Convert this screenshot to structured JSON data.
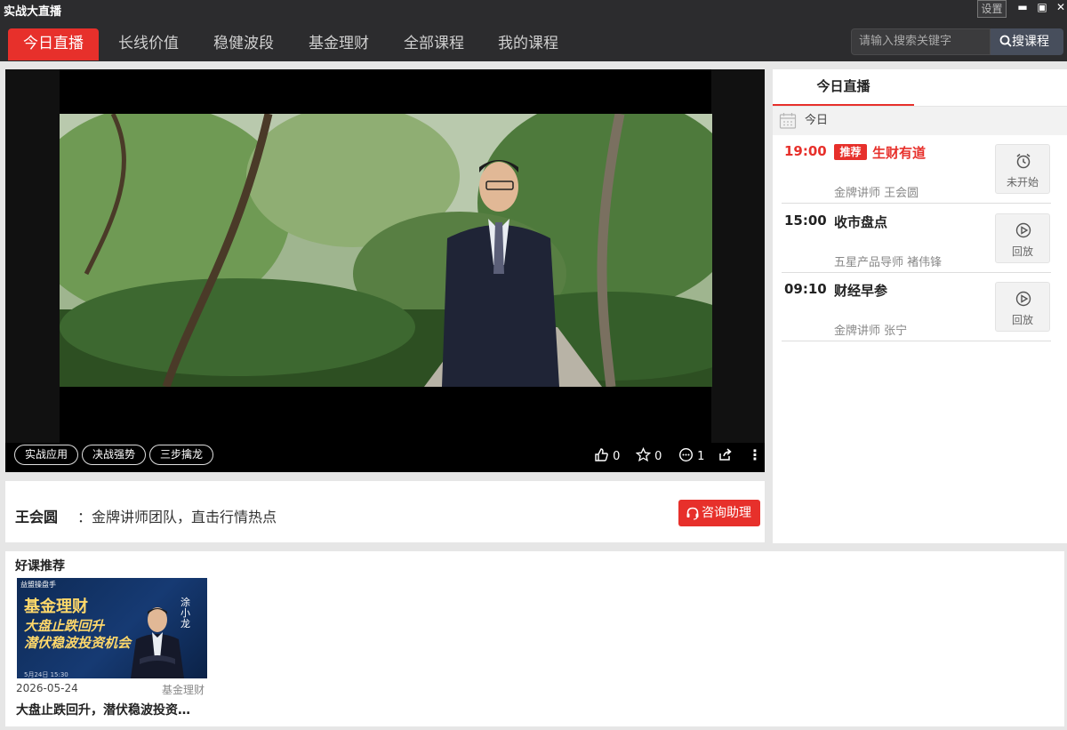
{
  "window": {
    "title": "实战大直播",
    "settings_label": "设置",
    "minimize_glyph": "▬",
    "maximize_glyph": "▣",
    "close_glyph": "✕"
  },
  "nav": {
    "tabs": [
      {
        "label": "今日直播",
        "active": true
      },
      {
        "label": "长线价值",
        "active": false
      },
      {
        "label": "稳健波段",
        "active": false
      },
      {
        "label": "基金理财",
        "active": false
      },
      {
        "label": "全部课程",
        "active": false
      },
      {
        "label": "我的课程",
        "active": false
      }
    ],
    "search_placeholder": "请输入搜索关键字",
    "search_button": "搜课程"
  },
  "player": {
    "tags": [
      "实战应用",
      "决战强势",
      "三步擒龙"
    ],
    "likes": "0",
    "favorites": "0",
    "comments": "1",
    "more_glyph": "⋮"
  },
  "info": {
    "name": "王会圆",
    "desc": "：金牌讲师团队，直击行情热点",
    "consult_button": "咨询助理"
  },
  "schedule": {
    "tab": "今日直播",
    "today_label": "今日",
    "items": [
      {
        "time": "19:00",
        "badge": "推荐",
        "name": "生财有道",
        "teacher": "金牌讲师 王会圆",
        "action": "未开始",
        "icon": "alarm-clock-icon"
      },
      {
        "time": "15:00",
        "badge": "",
        "name": "收市盘点",
        "teacher": "五星产品导师 褚伟锋",
        "action": "回放",
        "icon": "play-circle-icon"
      },
      {
        "time": "09:10",
        "badge": "",
        "name": "财经早参",
        "teacher": "金牌讲师 张宁",
        "action": "回放",
        "icon": "play-circle-icon"
      }
    ]
  },
  "recommend": {
    "title": "好课推荐",
    "course": {
      "thumb_brand": "益盟操盘手",
      "thumb_title": "基金理财",
      "thumb_line1": "大盘止跌回升",
      "thumb_line2": "潜伏稳波投资机会",
      "thumb_name": "涂小龙",
      "thumb_date": "5月24日 15:30",
      "date": "2026-05-24",
      "category": "基金理财",
      "name": "大盘止跌回升，潜伏稳波投资…"
    }
  },
  "colors": {
    "accent": "#e7302b",
    "chrome": "#2c2c2e"
  }
}
